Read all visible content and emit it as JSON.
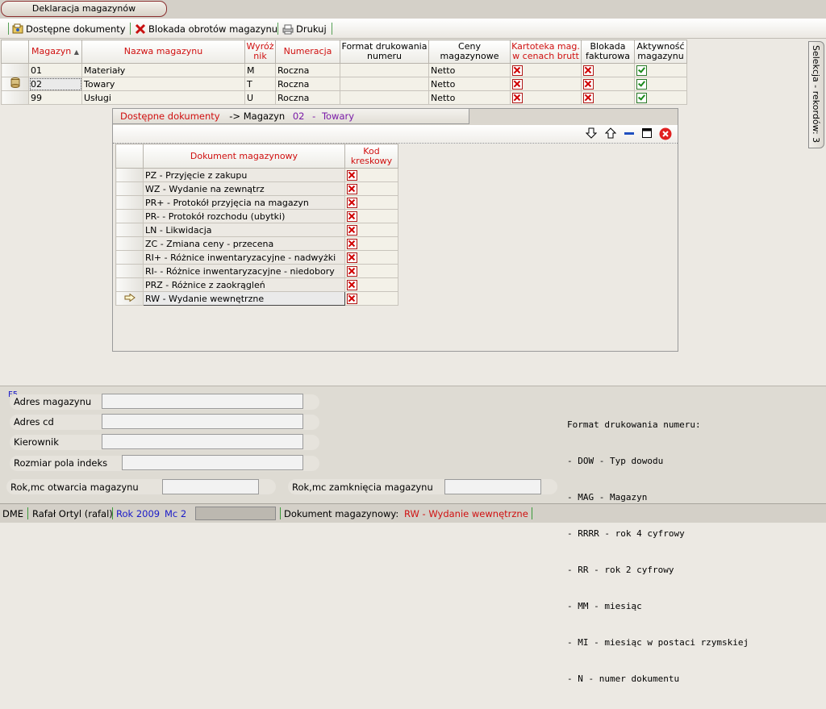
{
  "window": {
    "title": "Deklaracja magazynów"
  },
  "toolbar": {
    "items": [
      "Dostępne dokumenty",
      "Blokada obrotów magazynu",
      "Drukuj"
    ]
  },
  "main_table": {
    "headers": [
      "Magazyn",
      "Nazwa magazynu",
      "Wyróżnik",
      "Numeracja",
      "Format drukowania numeru",
      "Ceny magazynowe",
      "Kartoteka mag. w cenach brutt",
      "Blokada fakturowa",
      "Aktywność magazynu"
    ],
    "sort_indicator": "▲",
    "rows": [
      {
        "code": "01",
        "name": "Materiały",
        "mark": "M",
        "numbering": "Roczna",
        "format": "",
        "prices": "Netto",
        "kartoteka": false,
        "blokada": false,
        "active": true
      },
      {
        "code": "02",
        "name": "Towary",
        "mark": "T",
        "numbering": "Roczna",
        "format": "",
        "prices": "Netto",
        "kartoteka": false,
        "blokada": false,
        "active": true
      },
      {
        "code": "99",
        "name": "Usługi",
        "mark": "U",
        "numbering": "Roczna",
        "format": "",
        "prices": "Netto",
        "kartoteka": false,
        "blokada": false,
        "active": true
      }
    ]
  },
  "side_tab": {
    "label": "Selekcja - rekordów: 3"
  },
  "subwindow": {
    "title_prefix": "Dostępne dokumenty",
    "arrow": "->",
    "title_mid": "Magazyn",
    "code": "02",
    "dash": "-",
    "name": "Towary",
    "headers": [
      "Dokument magazynowy",
      "Kod kreskowy"
    ],
    "rows": [
      {
        "doc": "PZ - Przyjęcie z zakupu",
        "kod": false
      },
      {
        "doc": "WZ - Wydanie na zewnątrz",
        "kod": false
      },
      {
        "doc": "PR+ - Protokół przyjęcia na magazyn",
        "kod": false
      },
      {
        "doc": "PR- - Protokół rozchodu (ubytki)",
        "kod": false
      },
      {
        "doc": "LN - Likwidacja",
        "kod": false
      },
      {
        "doc": "ZC - Zmiana ceny - przecena",
        "kod": false
      },
      {
        "doc": "RI+ - Różnice inwentaryzacyjne - nadwyżki",
        "kod": false
      },
      {
        "doc": "RI- - Różnice inwentaryzacyjne - niedobory",
        "kod": false
      },
      {
        "doc": "PRZ - Różnice z zaokrągleń",
        "kod": false
      },
      {
        "doc": "RW - Wydanie wewnętrzne",
        "kod": false
      }
    ]
  },
  "form": {
    "hotkey": "F5",
    "labels": {
      "adres": "Adres magazynu",
      "adres_cd": "Adres cd",
      "kierownik": "Kierownik",
      "rozmiar": "Rozmiar pola indeks",
      "otwarcie": "Rok,mc otwarcia magazynu",
      "zamkniecie": "Rok,mc zamknięcia magazynu"
    },
    "values": {
      "adres": "",
      "adres_cd": "",
      "kierownik": "",
      "rozmiar": "",
      "otwarcie": "",
      "zamkniecie": ""
    },
    "format_help": [
      "Format drukowania numeru:",
      "- DOW - Typ dowodu",
      "- MAG - Magazyn",
      "- RRRR - rok 4 cyfrowy",
      "- RR - rok 2 cyfrowy",
      "- MM - miesiąc",
      "- MI - miesiąc w postaci rzymskiej",
      "- N - numer dokumentu"
    ]
  },
  "status": {
    "app": "DME",
    "user": "Rafał Ortyl (rafal)",
    "year": "Rok 2009",
    "month": "Mc 2",
    "doc_label": "Dokument magazynowy:",
    "doc_value": "RW - Wydanie wewnętrzne"
  },
  "colors": {
    "accent_red": "#d01010",
    "purple": "#7a1aa8",
    "blue": "#1a1ac8"
  }
}
